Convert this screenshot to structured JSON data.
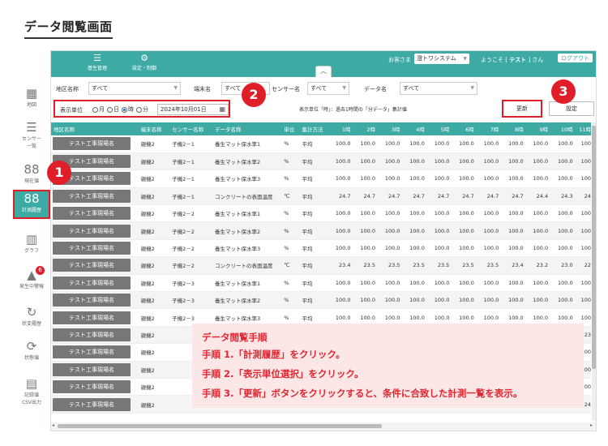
{
  "page_title": "データ閲覧画面",
  "topbar": {
    "nav": [
      {
        "icon": "list-icon",
        "label": "基生管理"
      },
      {
        "icon": "user-settings-icon",
        "label": "設定・制御"
      }
    ],
    "collapse_label": "︿",
    "client_label": "お客さま",
    "client_value": "澄トワシステム",
    "welcome_prefix": "ようこそ [",
    "user_name": "テスト",
    "welcome_suffix": "] さん",
    "logout_label": "ログアウト"
  },
  "sidebar": [
    {
      "icon": "map-icon",
      "label": "地図"
    },
    {
      "icon": "sensor-list-icon",
      "label": "センサー\n一覧"
    },
    {
      "icon": "current-value-icon",
      "label": "現在値"
    },
    {
      "icon": "history-icon",
      "label": "計測履歴",
      "active": true
    },
    {
      "icon": "graph-icon",
      "label": "グラフ"
    },
    {
      "icon": "bell-icon",
      "label": "発生中警報",
      "badge": "6"
    },
    {
      "icon": "status-history-icon",
      "label": "状変履歴"
    },
    {
      "icon": "refresh-icon",
      "label": "状態値"
    },
    {
      "icon": "csv-icon",
      "label": "記録値\nCSV出力"
    }
  ],
  "filters": {
    "region_label": "地区名称",
    "region_value": "すべて",
    "terminal_label": "端末名",
    "terminal_value": "すべて",
    "sensor_label": "センサー名",
    "sensor_value": "すべて",
    "data_label": "データ名",
    "data_value": "すべて",
    "unit_label": "表示単位",
    "unit_options": [
      {
        "label": "月",
        "checked": false
      },
      {
        "label": "日",
        "checked": false
      },
      {
        "label": "時",
        "checked": true
      },
      {
        "label": "分",
        "checked": false
      }
    ],
    "date_value": "2024年10月01日",
    "unit_description": "表示単位「時」：過去1時間の「分データ」集計値",
    "update_label": "更新",
    "setting_label": "設定"
  },
  "table": {
    "headers": [
      "地区名称",
      "端末名称",
      "センサー名称",
      "データ名称",
      "単位",
      "集計方法",
      "1時",
      "2時",
      "3時",
      "4時",
      "5時",
      "6時",
      "7時",
      "8時",
      "9時",
      "10時",
      "11時"
    ],
    "rows": [
      [
        "テスト工事現場名",
        "親機2",
        "子機2－1",
        "養生マット保水率1",
        "%",
        "平均",
        "100.0",
        "100.0",
        "100.0",
        "100.0",
        "100.0",
        "100.0",
        "100.0",
        "100.0",
        "100.0",
        "100.0",
        "100"
      ],
      [
        "テスト工事現場名",
        "親機2",
        "子機2－1",
        "養生マット保水率2",
        "%",
        "平均",
        "100.0",
        "100.0",
        "100.0",
        "100.0",
        "100.0",
        "100.0",
        "100.0",
        "100.0",
        "100.0",
        "100.0",
        "100"
      ],
      [
        "テスト工事現場名",
        "親機2",
        "子機2－1",
        "養生マット保水率3",
        "%",
        "平均",
        "100.0",
        "100.0",
        "100.0",
        "100.0",
        "100.0",
        "100.0",
        "100.0",
        "100.0",
        "100.0",
        "100.0",
        "100"
      ],
      [
        "テスト工事現場名",
        "親機2",
        "子機2－1",
        "コンクリートの表面温度",
        "℃",
        "平均",
        "24.7",
        "24.7",
        "24.7",
        "24.7",
        "24.7",
        "24.7",
        "24.7",
        "24.7",
        "24.4",
        "24.3",
        "24"
      ],
      [
        "テスト工事現場名",
        "親機2",
        "子機2－2",
        "養生マット保水率1",
        "%",
        "平均",
        "100.0",
        "100.0",
        "100.0",
        "100.0",
        "100.0",
        "100.0",
        "100.0",
        "100.0",
        "100.0",
        "100.0",
        "100"
      ],
      [
        "テスト工事現場名",
        "親機2",
        "子機2－2",
        "養生マット保水率2",
        "%",
        "平均",
        "100.0",
        "100.0",
        "100.0",
        "100.0",
        "100.0",
        "100.0",
        "100.0",
        "100.0",
        "100.0",
        "100.0",
        "100"
      ],
      [
        "テスト工事現場名",
        "親機2",
        "子機2－2",
        "養生マット保水率3",
        "%",
        "平均",
        "100.0",
        "100.0",
        "100.0",
        "100.0",
        "100.0",
        "100.0",
        "100.0",
        "100.0",
        "100.0",
        "100.0",
        "100"
      ],
      [
        "テスト工事現場名",
        "親機2",
        "子機2－2",
        "コンクリートの表面温度",
        "℃",
        "平均",
        "23.4",
        "23.5",
        "23.5",
        "23.5",
        "23.5",
        "23.5",
        "23.5",
        "23.4",
        "23.2",
        "23.0",
        "22"
      ],
      [
        "テスト工事現場名",
        "親機2",
        "子機2－3",
        "養生マット保水率1",
        "%",
        "平均",
        "100.0",
        "100.0",
        "100.0",
        "100.0",
        "100.0",
        "100.0",
        "100.0",
        "100.0",
        "100.0",
        "100.0",
        "100"
      ],
      [
        "テスト工事現場名",
        "親機2",
        "子機2－3",
        "養生マット保水率2",
        "%",
        "平均",
        "100.0",
        "100.0",
        "100.0",
        "100.0",
        "100.0",
        "100.0",
        "100.0",
        "100.0",
        "100.0",
        "100.0",
        "100"
      ],
      [
        "テスト工事現場名",
        "親機2",
        "子機2－3",
        "養生マット保水率3",
        "%",
        "平均",
        "100.0",
        "100.0",
        "100.0",
        "100.0",
        "100.0",
        "100.0",
        "100.0",
        "100.0",
        "100.0",
        "100.0",
        "100"
      ],
      [
        "テスト工事現場名",
        "親機2",
        "",
        "",
        "",
        "",
        "",
        "",
        "",
        "",
        "",
        "",
        "",
        "",
        "",
        "",
        "23"
      ],
      [
        "テスト工事現場名",
        "親機2",
        "",
        "",
        "",
        "",
        "",
        "",
        "",
        "",
        "",
        "",
        "",
        "",
        "",
        "",
        "100"
      ],
      [
        "テスト工事現場名",
        "親機2",
        "",
        "",
        "",
        "",
        "",
        "",
        "",
        "",
        "",
        "",
        "",
        "",
        "",
        "",
        "100"
      ],
      [
        "テスト工事現場名",
        "親機2",
        "",
        "",
        "",
        "",
        "",
        "",
        "",
        "",
        "",
        "",
        "",
        "",
        "",
        "",
        "100"
      ],
      [
        "テスト工事現場名",
        "親機2",
        "",
        "",
        "",
        "",
        "",
        "",
        "",
        "",
        "",
        "",
        "",
        "",
        "",
        "",
        "24"
      ]
    ]
  },
  "steps": [
    "1",
    "2",
    "3"
  ],
  "instructions": {
    "title": "データ閲覧手順",
    "lines": [
      "手順 1.「計測履歴」をクリック。",
      "手順 2.「表示単位選択」をクリック。",
      "手順 3.「更新」ボタンをクリックすると、条件に合致した計測一覧を表示。"
    ]
  }
}
